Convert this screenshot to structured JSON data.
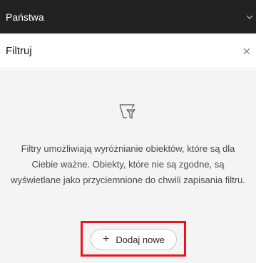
{
  "layer_bar": {
    "title": "Państwa",
    "chevron_icon": "chevron-down-icon"
  },
  "panel": {
    "title": "Filtruj",
    "close_icon": "close-icon"
  },
  "empty_state": {
    "icon": "filter-icon",
    "description": "Filtry umożliwiają wyróżnianie obiektów, które są dla Ciebie ważne. Obiekty, które nie są zgodne, są wyświetlane jako przyciemnione do chwili zapisania filtru.",
    "add_button_icon": "+",
    "add_button_label": "Dodaj nowe"
  },
  "colors": {
    "header_bg": "#222222",
    "body_bg": "#f4f4f4",
    "highlight_border": "#e8151a"
  }
}
